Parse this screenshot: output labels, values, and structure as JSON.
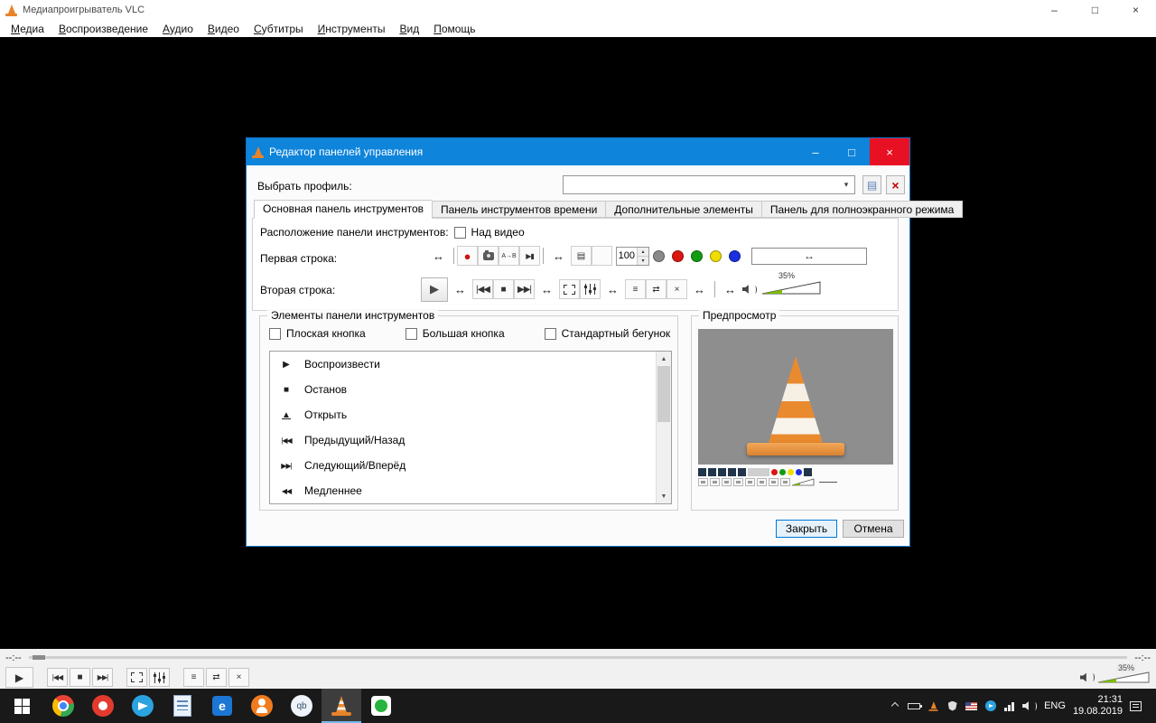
{
  "window": {
    "title": "Медиапроигрыватель VLC"
  },
  "menu": {
    "items": [
      "Медиа",
      "Воспроизведение",
      "Аудио",
      "Видео",
      "Субтитры",
      "Инструменты",
      "Вид",
      "Помощь"
    ]
  },
  "icons": {
    "minimize": "–",
    "maximize": "□",
    "close": "×",
    "dropdown": "▾",
    "delete_profile": "×",
    "profile_doc": "▤",
    "spacer": "↔",
    "record": "●",
    "ab_loop": "A→B",
    "frame": "▶▮",
    "playlist_box": "▤",
    "menu_lines": "≡",
    "loop": "⇄",
    "shuffle": "×",
    "play": "▶",
    "stop": "■",
    "prev": "|◀◀",
    "next": "▶▶|",
    "spin_up": "▴",
    "spin_down": "▾",
    "scroll_up": "▲",
    "scroll_down": "▼",
    "qbittorrent": "qb",
    "edge_letter": "e"
  },
  "dialog": {
    "title": "Редактор панелей управления",
    "profile_label": "Выбрать профиль:",
    "tabs": [
      "Основная панель инструментов",
      "Панель инструментов времени",
      "Дополнительные элементы",
      "Панель для полноэкранного режима"
    ],
    "position_label": "Расположение панели инструментов:",
    "above_video": "Над видео",
    "row1_label": "Первая строка:",
    "row2_label": "Вторая строка:",
    "spinner_value": "100",
    "volume_label": "35%",
    "elements_legend": "Элементы панели инструментов",
    "checkboxes": [
      "Плоская кнопка",
      "Большая кнопка",
      "Стандартный бегунок"
    ],
    "list": [
      {
        "glyph": "▶",
        "label": "Воспроизвести"
      },
      {
        "glyph": "■",
        "label": "Останов"
      },
      {
        "glyph": "▲",
        "label": "Открыть"
      },
      {
        "glyph": "|◀◀",
        "label": "Предыдущий/Назад"
      },
      {
        "glyph": "▶▶|",
        "label": "Следующий/Вперёд"
      },
      {
        "glyph": "◀◀",
        "label": "Медленнее"
      }
    ],
    "preview_legend": "Предпросмотр",
    "buttons": {
      "close": "Закрыть",
      "cancel": "Отмена"
    },
    "dot_styles": [
      "background:#8a8a8a",
      "background:#da1710",
      "background:#119c11",
      "background:#efdc00",
      "background:#1a2fdd"
    ]
  },
  "player": {
    "elapsed": "--:--",
    "total": "--:--",
    "volume": "35%"
  },
  "taskbar": {
    "lang": "ENG",
    "time": "21:31",
    "date": "19.08.2019"
  },
  "colors": {
    "accent_blue": "#0e84da",
    "close_red": "#e81123",
    "volume_green": "#7dbd00",
    "cone_orange": "#e98a2e"
  }
}
